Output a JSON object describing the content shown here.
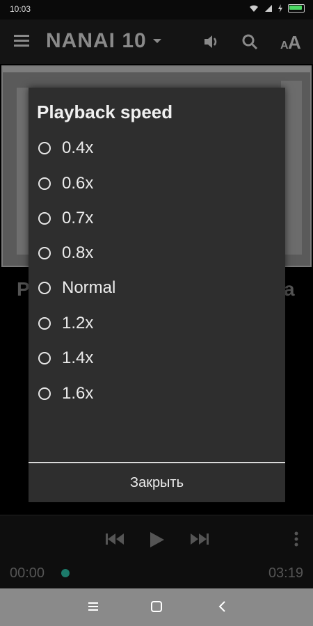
{
  "status_bar": {
    "time": "10:03"
  },
  "toolbar": {
    "title": "NANAI 10"
  },
  "background": {
    "title_left": "P",
    "title_right": "a"
  },
  "player": {
    "elapsed": "00:00",
    "duration": "03:19",
    "progress": 0.0
  },
  "dialog": {
    "title": "Playback speed",
    "options": [
      "0.4x",
      "0.6x",
      "0.7x",
      "0.8x",
      "Normal",
      "1.2x",
      "1.4x",
      "1.6x"
    ],
    "close_label": "Закрыть"
  },
  "colors": {
    "accent": "#1c7a6a",
    "battery": "#4cd964"
  }
}
